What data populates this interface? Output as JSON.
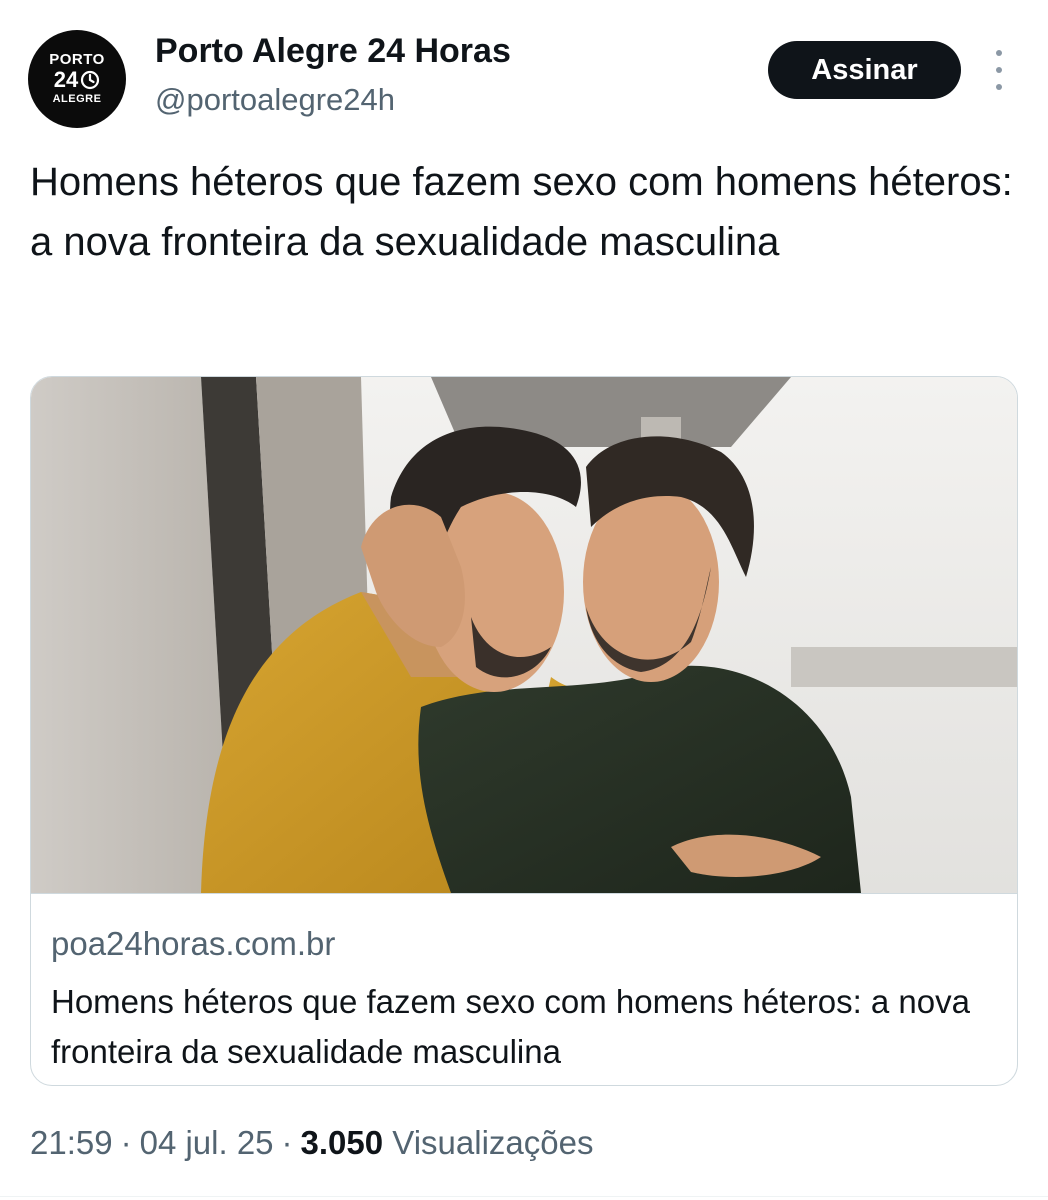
{
  "author": {
    "name": "Porto Alegre 24 Horas",
    "handle": "@portoalegre24h",
    "avatar": {
      "line1": "PORTO",
      "line2": "24",
      "line3": "ALEGRE",
      "icon": "clock-icon"
    }
  },
  "subscribe_label": "Assinar",
  "more_icon": "more-vertical-icon",
  "tweet_text": "Homens héteros que fazem sexo com homens héteros: a nova fronteira da sexualidade masculina",
  "link_card": {
    "domain": "poa24horas.com.br",
    "title": "Homens héteros que fazem sexo com homens héteros: a nova fronteira da sexualidade masculina",
    "image": "photo-two-men-embracing"
  },
  "meta": {
    "time": "21:59",
    "date": "04 jul. 25",
    "separator": "·",
    "views_count": "3.050",
    "views_label": "Visualizações"
  },
  "colors": {
    "text_primary": "#0f1419",
    "text_secondary": "#536471",
    "button_bg": "#0f1419",
    "border": "#cfd9de"
  }
}
